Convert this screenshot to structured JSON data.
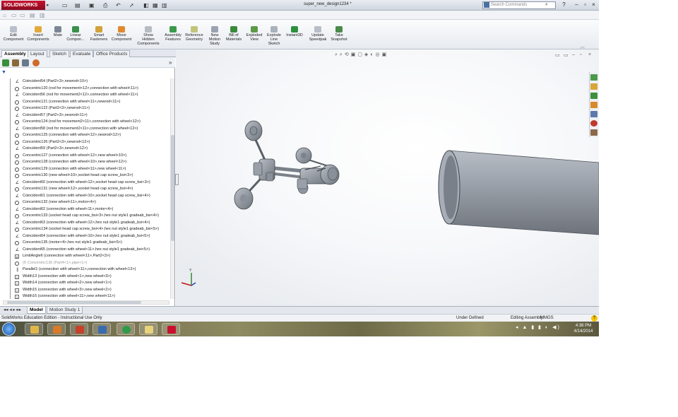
{
  "app": {
    "brand": "SOLIDWORKS",
    "document_title": "super_new_design1234 *",
    "search_placeholder": "Search Commands"
  },
  "command_manager": [
    {
      "id": "edit-component",
      "label": "Edit\nComponent"
    },
    {
      "id": "insert-components",
      "label": "Insert\nComponents"
    },
    {
      "id": "mate",
      "label": "Mate"
    },
    {
      "id": "linear-component",
      "label": "Linear\nCompon..."
    },
    {
      "id": "smart-fasteners",
      "label": "Smart\nFasteners"
    },
    {
      "id": "move-component",
      "label": "Move\nComponent"
    },
    {
      "id": "show-hidden-components",
      "label": "Show\nHidden\nComponents"
    },
    {
      "id": "assembly-features",
      "label": "Assembly\nFeatures"
    },
    {
      "id": "reference-geometry",
      "label": "Reference\nGeometry"
    },
    {
      "id": "new-motion-study",
      "label": "New\nMotion\nStudy"
    },
    {
      "id": "bill-of-materials",
      "label": "Bill of\nMaterials"
    },
    {
      "id": "exploded-view",
      "label": "Exploded\nView"
    },
    {
      "id": "explode-line-sketch",
      "label": "Explode\nLine\nSketch"
    },
    {
      "id": "instant3d",
      "label": "Instant3D"
    },
    {
      "id": "update-speedpak",
      "label": "Update\nSpeedpak"
    },
    {
      "id": "take-snapshot",
      "label": "Take\nSnapshot"
    }
  ],
  "tabs": [
    "Assembly",
    "Layout",
    "Sketch",
    "Evaluate",
    "Office Products"
  ],
  "tree": [
    {
      "icon": "coincident",
      "label": "Coincident54 (Part2<3>,newrod<10>)"
    },
    {
      "icon": "concentric",
      "label": "Concentric120 (rod for movement<12>,connection with wheel<11>)"
    },
    {
      "icon": "coincident",
      "label": "Coincident56 (rod for movement2<12>,connection with wheel<11>)"
    },
    {
      "icon": "concentric",
      "label": "Concentric121 (connection with wheel<11>,newrod<11>)"
    },
    {
      "icon": "concentric",
      "label": "Concentric122 (Part2<3>,newrod<11>)"
    },
    {
      "icon": "coincident",
      "label": "Coincident57 (Part2<3>,newrod<11>)"
    },
    {
      "icon": "concentric",
      "label": "Concentric124 (rod for movement2<11>,connection with wheel<12>)"
    },
    {
      "icon": "coincident",
      "label": "Coincident58 (rod for movement2<11>,connection with wheel<12>)"
    },
    {
      "icon": "concentric",
      "label": "Concentric125 (connection with wheel<12>,newrod<12>)"
    },
    {
      "icon": "concentric",
      "label": "Concentric126 (Part2<3>,newrod<12>)"
    },
    {
      "icon": "coincident",
      "label": "Coincident59 (Part2<3>,newrod<12>)"
    },
    {
      "icon": "concentric",
      "label": "Concentric127 (connection with wheel<12>,new wheel<10>)"
    },
    {
      "icon": "concentric",
      "label": "Concentric128 (connection with wheel<10>,new wheel<12>)"
    },
    {
      "icon": "concentric",
      "label": "Concentric129 (connection with wheel<11>,new wheel<11>)"
    },
    {
      "icon": "concentric",
      "label": "Concentric130 (new wheel<10>,socket head cap screw_bsi<3>)"
    },
    {
      "icon": "coincident",
      "label": "Coincident60 (connection with wheel<12>,socket head cap screw_bsi<3>)"
    },
    {
      "icon": "concentric",
      "label": "Concentric131 (new wheel<12>,socket head cap screw_bsi<4>)"
    },
    {
      "icon": "coincident",
      "label": "Coincident61 (connection with wheel<10>,socket head cap screw_bsi<4>)"
    },
    {
      "icon": "concentric",
      "label": "Concentric132 (new wheel<11>,motor<4>)"
    },
    {
      "icon": "coincident",
      "label": "Coincident62 (connection with wheel<11>,motor<4>)"
    },
    {
      "icon": "concentric",
      "label": "Concentric133 (socket head cap screw_bsi<3>,hex nut style1 gradeab_bsi<4>)"
    },
    {
      "icon": "coincident",
      "label": "Coincident63 (connection with wheel<12>,hex nut style1 gradeab_bsi<4>)"
    },
    {
      "icon": "concentric",
      "label": "Concentric134 (socket head cap screw_bsi<4>,hex nut style1 gradeab_bsi<5>)"
    },
    {
      "icon": "coincident",
      "label": "Coincident64 (connection with wheel<10>,hex nut style1 gradeab_bsi<5>)"
    },
    {
      "icon": "concentric",
      "label": "Concentric135 (motor<4>,hex nut style1 gradeab_bsi<5>)"
    },
    {
      "icon": "coincident",
      "label": "Coincident65 (connection with wheel<11>,hex nut style1 gradeab_bsi<5>)"
    },
    {
      "icon": "limitangle",
      "label": "LimitAngle6 (connection with wheel<11>,Part2<3>)"
    },
    {
      "icon": "concentric",
      "label": "(f) Concentric136 (Part4<1>,pipe<1>)",
      "suppressed": true
    },
    {
      "icon": "parallel",
      "label": "Parallel1 (connection with wheel<11>,connection with wheel<12>)"
    },
    {
      "icon": "width",
      "label": "Width13 (connection with wheel<1>,new wheel<3>)"
    },
    {
      "icon": "width",
      "label": "Width14 (connection with wheel<2>,new wheel<1>)"
    },
    {
      "icon": "width",
      "label": "Width15 (connection with wheel<3>,new wheel<2>)"
    },
    {
      "icon": "width",
      "label": "Width16 (connection with wheel<11>,new wheel<11>)"
    }
  ],
  "model_tabs": [
    "Model",
    "Motion Study 1"
  ],
  "status": {
    "edition": "SolidWorks Education Edition - Instructional Use Only",
    "definition": "Under Defined",
    "mode": "Editing Assembly",
    "units": "MMGS"
  },
  "clock": {
    "time": "4:38 PM",
    "date": "4/14/2014"
  },
  "colors": {
    "brand_red": "#c8102e",
    "part_gray": "#8f959f"
  }
}
